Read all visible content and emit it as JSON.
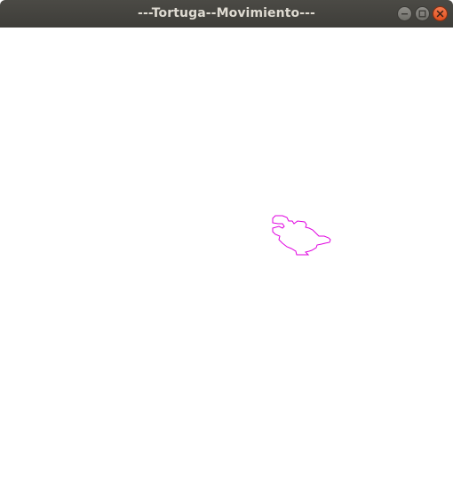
{
  "window": {
    "title": "---Tortuga--Movimiento---"
  },
  "controls": {
    "minimize_icon": "minimize-icon",
    "maximize_icon": "maximize-icon",
    "close_icon": "close-icon"
  },
  "canvas": {
    "background": "#ffffff",
    "turtle_color": "#e000e0"
  },
  "colors": {
    "titlebar": "#45443f",
    "title_text": "#dfdbd2",
    "close_button": "#e9592b",
    "window_button": "#7e7d78"
  }
}
